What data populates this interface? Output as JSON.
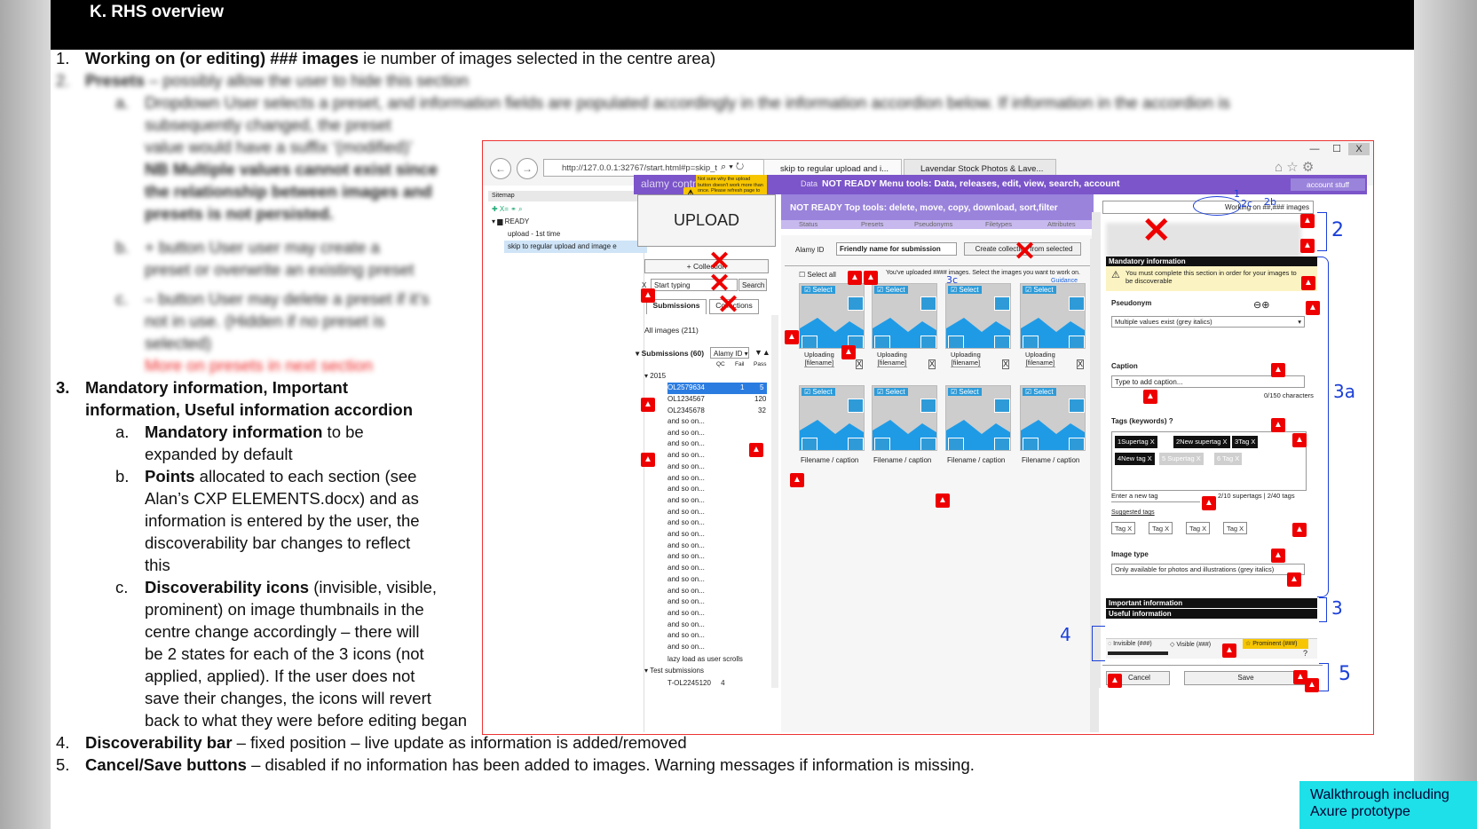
{
  "header": {
    "title": "K.   RHS overview"
  },
  "items": [
    {
      "num": "1.",
      "bold": "Working on (or editing) ### images",
      "rest": " ie number of images selected in the centre area)"
    },
    {
      "num": "2.",
      "bold": "Presets",
      "rest": " – possibly allow the user to hide this section"
    }
  ],
  "blurred": {
    "a_label": "a.",
    "a_lines": [
      "Dropdown User selects a preset, and information fields are populated accordingly in the information accordion below. If information in the accordion is",
      "subsequently changed, the preset",
      "value would have a suffix ‘(modified)’",
      "NB Multiple values cannot exist since",
      "the relationship between images and",
      "presets is not persisted."
    ],
    "b_label": "b.",
    "b_lines": [
      "+ button User user may create a",
      "preset or overwrite an existing preset"
    ],
    "c_label": "c.",
    "c_lines": [
      "– button User may delete a preset if it’s",
      "not in use. (Hidden if no preset is",
      "selected)"
    ],
    "red_line": "More on presets in next section"
  },
  "item3": {
    "num": "3.",
    "line1": "Mandatory information, Important",
    "line2": "information, Useful information accordion",
    "a": {
      "label": "a.",
      "bold": "Mandatory information",
      "rest": " to be",
      "line2": "expanded by default"
    },
    "b": {
      "label": "b.",
      "bold": "Points",
      "rest": " allocated to each section (see",
      "lines": [
        "Alan’s CXP ELEMENTS.docx) and as",
        "information is entered by the user, the",
        "discoverability bar changes to reflect",
        "this"
      ]
    },
    "c": {
      "label": "c.",
      "bold": "Discoverability icons",
      "rest": " (invisible, visible,",
      "lines": [
        "prominent) on image thumbnails in the",
        "centre change accordingly – there will",
        "be 2 states for each of the 3 icons (not",
        "applied, applied).  If the user does not",
        "save their changes, the icons will revert",
        "back to what they were before editing began"
      ]
    }
  },
  "item4": {
    "num": "4.",
    "bold": "Discoverability bar",
    "rest": " – fixed position – live update as information is added/removed"
  },
  "item5": {
    "num": "5.",
    "bold": "Cancel/Save buttons",
    "rest": " – disabled if no information has been added to images. Warning messages if information is missing."
  },
  "badge": {
    "line1": "Walkthrough including",
    "line2": "Axure prototype"
  },
  "mock": {
    "window": {
      "min": "—",
      "max": "☐",
      "close": "X"
    },
    "address": "http://127.0.0.1:32767/start.html#p=skip_t",
    "tab1": "skip to regular upload and i...",
    "tab2": "Lavendar Stock Photos & Lave...",
    "sitemap": {
      "title": "Sitemap",
      "ready": "READY",
      "page1": "upload - 1st time",
      "page2": "skip to regular upload and image e"
    },
    "brand": "alamy contributors",
    "data_label": "Data",
    "menu_title": "NOT READY Menu tools: Data, releases, edit, view, search, account",
    "account": "account stuff",
    "note": "Not sure why the upload button doesn't work more than once. Please refresh page to get it working again...",
    "upload": "UPLOAD",
    "top_tools": "NOT READY Top tools: delete, move, copy, download, sort,filter",
    "sub_tabs": [
      "Status",
      "Presets",
      "Pseudonyms",
      "Filetypes",
      "Attributes"
    ],
    "collection_btn": "+ Collection",
    "start_typing": "Start typing",
    "search": "Search",
    "submissions_tab": "Submissions",
    "collections_tab": "Collections",
    "all_images": "All images (211)",
    "submissions_hdr": "Submissions (60)",
    "alamy_id_select": "Alamy ID",
    "qc": "QC",
    "fail": "Fail",
    "pass": "Pass",
    "year": "2015",
    "rows": [
      {
        "id": "OL2579634",
        "n1": "1",
        "n2": "5"
      },
      {
        "id": "OL1234567",
        "n1": "120",
        "n2": ""
      },
      {
        "id": "OL2345678",
        "n1": "32",
        "n2": ""
      }
    ],
    "andsoon": "and so on...",
    "lazy": "lazy load as user scrolls",
    "test_subs": "Test submissions",
    "test_row": "T-OL2245120",
    "test_row_n": "4",
    "alamy_id_lbl": "Alamy ID",
    "friendly": "Friendly name for submission",
    "create_coll": "Create collection from selected",
    "select_all": "Select all",
    "uploaded_msg": "You've uploaded #### images. Select the images you want to work on.",
    "guidance": "Guidance",
    "select": "Select",
    "uploading": "Uploading",
    "filename": "[filename]",
    "fcaption": "Filename / caption",
    "working_on": "Working on ##,### images",
    "mandatory": "Mandatory information",
    "must_complete": "You must complete this section in order for your images to be discoverable",
    "pseudonym": "Pseudonym",
    "multi": "Multiple values exist (grey italics)",
    "caption": "Caption",
    "caption_ph": "Type to add caption...",
    "chars": "0/150 characters",
    "tags": "Tags (keywords)",
    "tag_items": [
      "1Supertag X",
      "2New supertag X",
      "3Tag X",
      "4New tag X",
      "5 Supertag X",
      "6 Tag X"
    ],
    "enter_tag": "Enter a new tag",
    "tag_count": "2/10 supertags | 2/40 tags",
    "suggested": "Suggested tags",
    "sugg_items": [
      "Tag X",
      "Tag X",
      "Tag X",
      "Tag X"
    ],
    "image_type": "Image type",
    "img_type_val": "Only available for photos and illustrations (grey italics)",
    "important": "Important information",
    "useful": "Useful information",
    "invisible": "Invisible (###)",
    "visible": "Visible (###)",
    "prominent": "Prominent (###)",
    "cancel": "Cancel",
    "save": "Save",
    "anno": {
      "a1": "1",
      "a2": "2",
      "a2b": "2b",
      "a2c": "2c",
      "a3": "3",
      "a3a": "3a",
      "a3c": "3c",
      "a4": "4",
      "a5": "5"
    }
  }
}
